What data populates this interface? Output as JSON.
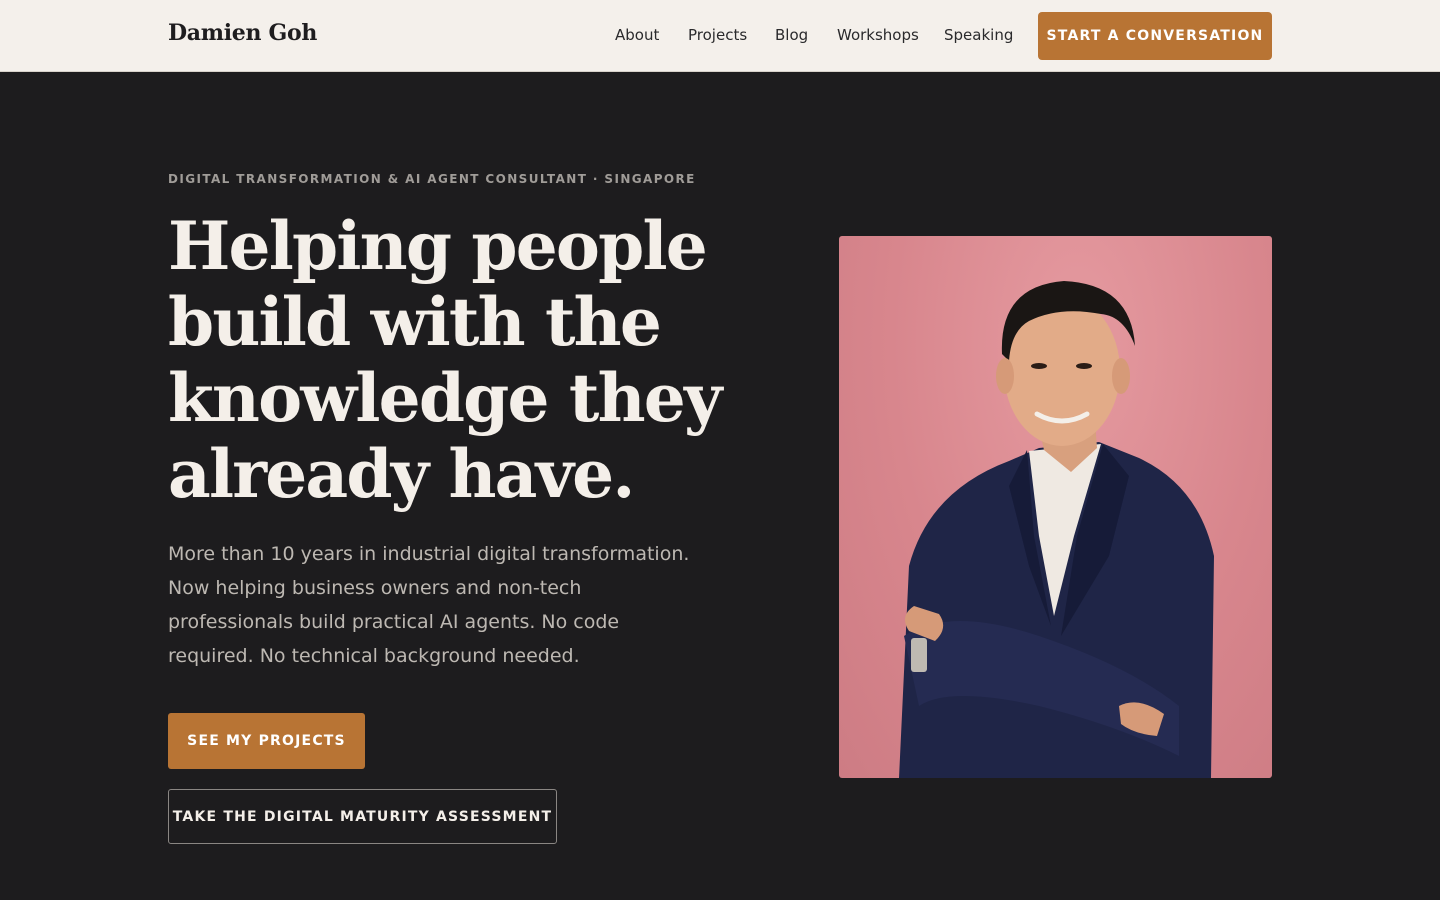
{
  "header": {
    "brand": "Damien Goh",
    "nav": [
      {
        "label": "About"
      },
      {
        "label": "Projects"
      },
      {
        "label": "Blog"
      },
      {
        "label": "Workshops"
      },
      {
        "label": "Speaking"
      }
    ],
    "cta_label": "START A CONVERSATION"
  },
  "hero": {
    "eyebrow": "DIGITAL TRANSFORMATION & AI AGENT CONSULTANT · SINGAPORE",
    "headline_lines": [
      "Helping people",
      "build with the",
      "knowledge they",
      "already have."
    ],
    "intro": "More than 10 years in industrial digital transformation. Now helping business owners and non-tech professionals build practical AI agents. No code required. No technical background needed.",
    "primary_button": "SEE MY PROJECTS",
    "secondary_button": "TAKE THE DIGITAL MATURITY ASSESSMENT"
  },
  "colors": {
    "header_bg": "#f4f0eb",
    "page_bg": "#1d1c1e",
    "accent": "#b87434",
    "portrait_bg": "#d8868d",
    "jacket": "#1f2547"
  }
}
